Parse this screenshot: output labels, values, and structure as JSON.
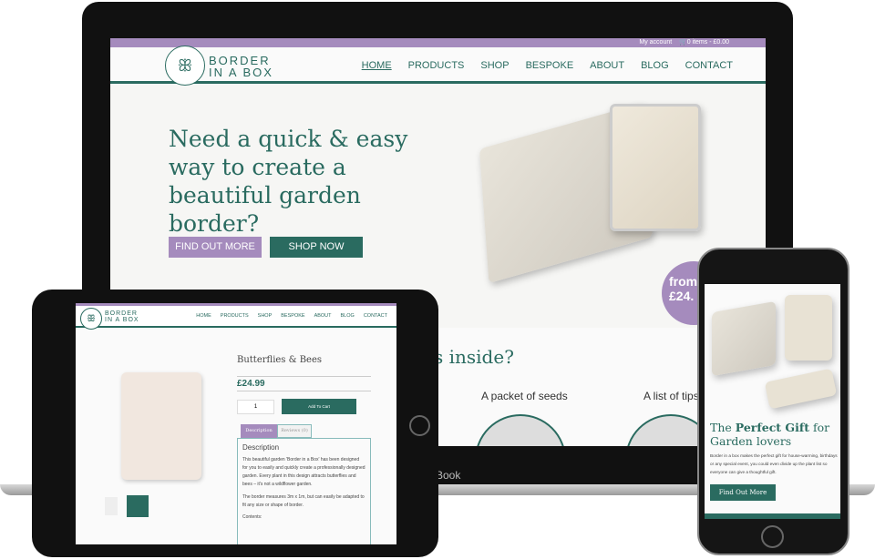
{
  "laptop": {
    "topbar": {
      "account": "My account",
      "cart": "0 items - £0.00"
    },
    "logo": {
      "line1": "BORDER",
      "line2": "IN A BOX"
    },
    "nav": [
      "HOME",
      "PRODUCTS",
      "SHOP",
      "BESPOKE",
      "ABOUT",
      "BLOG",
      "CONTACT"
    ],
    "hero_title": "Need a quick & easy way to create a beautiful garden border?",
    "find_out_more": "FIND OUT MORE",
    "shop_now": "SHOP NOW",
    "price_badge": "from £24.",
    "section_title": "s inside?",
    "features": [
      "A packet of seeds",
      "A list of tips"
    ],
    "brand": "Book"
  },
  "tablet": {
    "logo": {
      "line1": "BORDER",
      "line2": "IN A BOX"
    },
    "nav": [
      "HOME",
      "PRODUCTS",
      "SHOP",
      "BESPOKE",
      "ABOUT",
      "BLOG",
      "CONTACT"
    ],
    "product_title": "Butterflies & Bees",
    "price": "£24.99",
    "quantity": "1",
    "add_to_cart": "Add To Cart",
    "tabs": [
      "Description",
      "Reviews (0)"
    ],
    "desc_heading": "Description",
    "desc_p1": "This beautiful garden 'Border in a Box' has been designed for you to easily and quickly create a professionally designed garden.  Every plant in this design attracts butterflies and bees – it's not a wildflower garden.",
    "desc_p2": "The border measures 3m x 1m, but can easily be adapted to fit any size or shape of border.",
    "desc_p3": "Contents:"
  },
  "phone": {
    "title_a": "The ",
    "title_b": "Perfect Gift",
    "title_c": " for Garden lovers",
    "body": "Border in a box makes the perfect gift for house-warming, birthdays or any special event, you could even divide up the plant list so everyone can give a thoughtful gift.",
    "button": "Find Out More"
  },
  "colors": {
    "green": "#2a6b60",
    "purple": "#a58bbd"
  }
}
